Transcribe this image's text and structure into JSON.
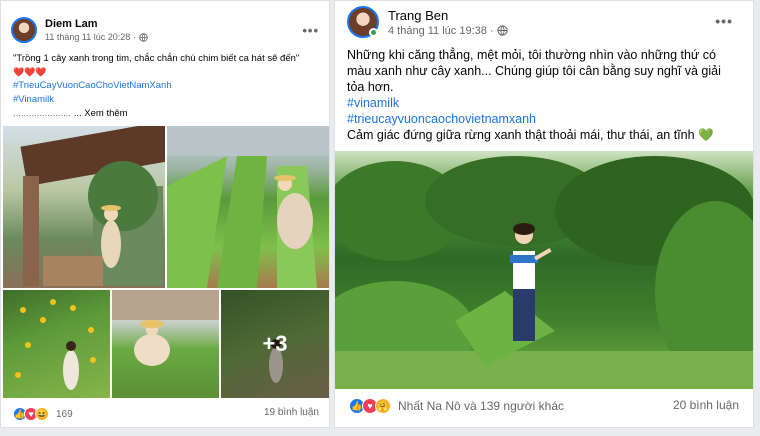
{
  "post1": {
    "author": "Diem Lam",
    "timestamp": "11 tháng 11 lúc 20:28",
    "privacy_icon": "globe-icon",
    "body_line1": "\"Trồng 1 cây xanh trong tim, chắc chắn chú chim biết ca hát sẽ đến\"",
    "hearts": "❤️❤️❤️",
    "hashtag1": "#TrieuCayVuonCaoChoVietNamXanh",
    "hashtag2": "#Vinamilk",
    "see_more_dots": "......................",
    "see_more": "... Xem thêm",
    "more_photos": "+3",
    "reaction_count": "169",
    "comments": "19 bình luận",
    "reactions": [
      "like",
      "love",
      "haha"
    ]
  },
  "post2": {
    "author": "Trang Ben",
    "timestamp": "4 tháng 11 lúc 19:38",
    "privacy_icon": "globe-icon",
    "body": "Những khi căng thẳng, mệt mỏi, tôi thường nhìn vào những thứ có màu xanh như cây xanh... Chúng giúp tôi cân bằng suy nghĩ và giải tỏa hơn.",
    "hashtag1": "#vinamilk",
    "hashtag2": "#trieucayvuoncaochovietnamxanh",
    "closing": "Cảm giác đứng giữa rừng xanh thật thoải mái, thư thái, an tĩnh 💚",
    "reaction_summary": "Nhất Na Nô và 139 người khác",
    "comments": "20 bình luận",
    "reactions": [
      "like",
      "love",
      "care"
    ]
  },
  "colors": {
    "link": "#1b74e4",
    "secondary_text": "#65676b",
    "like": "#1877f2",
    "love": "#f33e58",
    "care": "#f7b125"
  }
}
